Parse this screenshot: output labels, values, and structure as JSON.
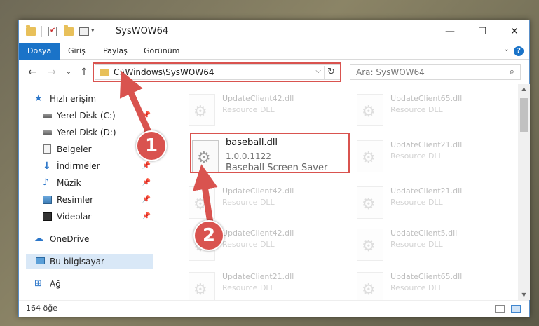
{
  "window": {
    "title": "SysWOW64",
    "minimize": "—",
    "maximize": "☐",
    "close": "✕"
  },
  "ribbon": {
    "tabs": [
      "Dosya",
      "Giriş",
      "Paylaş",
      "Görünüm"
    ],
    "expand_glyph": "⌄",
    "help": "?"
  },
  "nav": {
    "back": "←",
    "forward": "→",
    "recent": "⌄",
    "up": "↑"
  },
  "address": {
    "path": "C:\\Windows\\SysWOW64",
    "dropdown": "⌵",
    "refresh": "↻"
  },
  "search": {
    "placeholder": "Ara: SysWOW64",
    "icon": "⌕"
  },
  "sidebar": {
    "items": [
      {
        "label": "Hızlı erişim",
        "pin": ""
      },
      {
        "label": "Yerel Disk (C:)",
        "pin": "📌"
      },
      {
        "label": "Yerel Disk (D:)",
        "pin": "📌"
      },
      {
        "label": "Belgeler",
        "pin": "📌"
      },
      {
        "label": "İndirmeler",
        "pin": "📌"
      },
      {
        "label": "Müzik",
        "pin": "📌"
      },
      {
        "label": "Resimler",
        "pin": "📌"
      },
      {
        "label": "Videolar",
        "pin": "📌"
      },
      {
        "label": "OneDrive",
        "pin": ""
      },
      {
        "label": "Bu bilgisayar",
        "pin": ""
      },
      {
        "label": "Ağ",
        "pin": ""
      }
    ]
  },
  "files": [
    {
      "name": "UpdateClient42.dll",
      "desc": "Resource DLL"
    },
    {
      "name": "UpdateClient65.dll",
      "desc": "Resource DLL"
    },
    {
      "name": "baseball.dll",
      "desc": "1.0.0.1122",
      "desc2": "Baseball Screen Saver"
    },
    {
      "name": "UpdateClient21.dll",
      "desc": "Resource DLL"
    },
    {
      "name": "UpdateClient42.dll",
      "desc": "Resource DLL"
    },
    {
      "name": "UpdateClient21.dll",
      "desc": "Resource DLL"
    },
    {
      "name": "UpdateClient42.dll",
      "desc": "Resource DLL"
    },
    {
      "name": "UpdateClient5.dll",
      "desc": "Resource DLL"
    },
    {
      "name": "UpdateClient21.dll",
      "desc": "Resource DLL"
    },
    {
      "name": "UpdateClient65.dll",
      "desc": "Resource DLL"
    }
  ],
  "status": {
    "count": "164 öğe"
  },
  "annotations": {
    "step1": "1",
    "step2": "2",
    "color": "#d9534f"
  }
}
